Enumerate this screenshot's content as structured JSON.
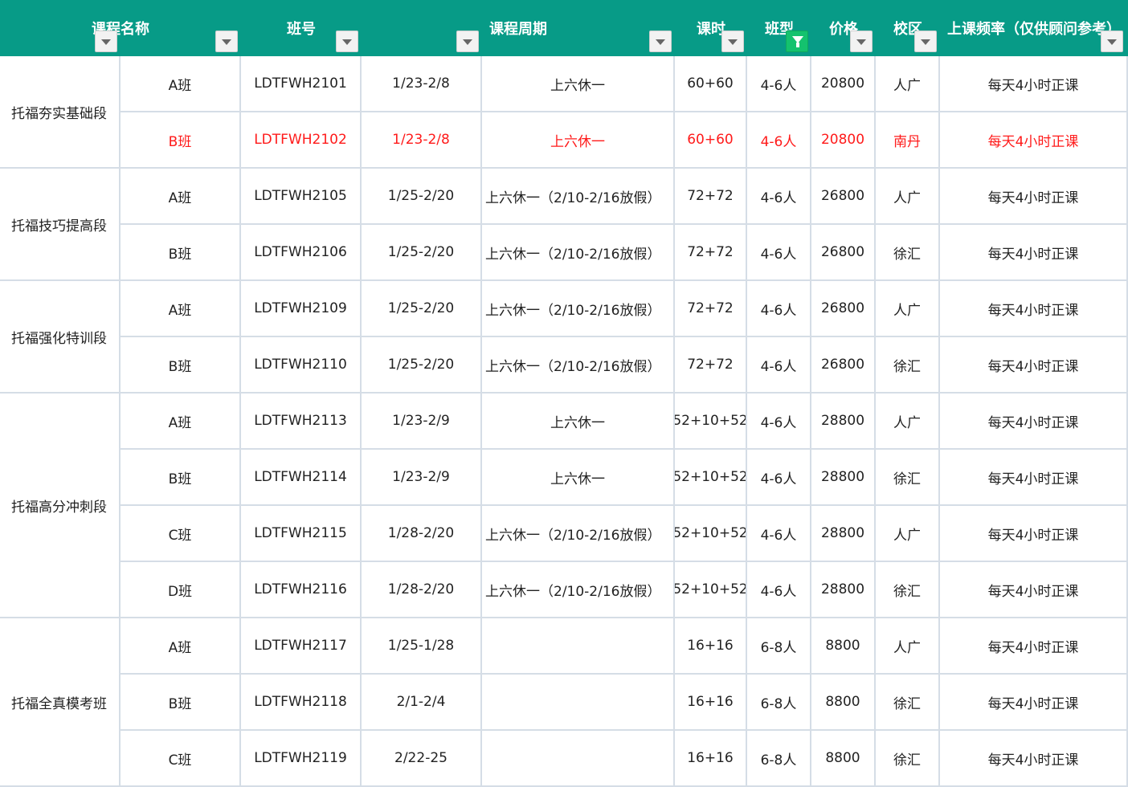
{
  "headers": [
    {
      "label": "课程名称",
      "filter_active": false
    },
    {
      "label": "班号",
      "filter_active": false
    },
    {
      "label": "课程周期",
      "filter_active": false
    },
    {
      "label": "课时",
      "filter_active": false
    },
    {
      "label": "班型",
      "filter_active": true
    },
    {
      "label": "价格",
      "filter_active": false
    },
    {
      "label": "校区",
      "filter_active": false
    },
    {
      "label": "上课频率（仅供顾问参考）",
      "filter_active": false
    }
  ],
  "groups": [
    {
      "name": "托福夯实基础段",
      "row_count": 2
    },
    {
      "name": "托福技巧提高段",
      "row_count": 2
    },
    {
      "name": "托福强化特训段",
      "row_count": 2
    },
    {
      "name": "托福高分冲刺段",
      "row_count": 4
    },
    {
      "name": "托福全真模考班",
      "row_count": 3
    }
  ],
  "rows": [
    {
      "class": "A班",
      "code": "LDTFWH2101",
      "dates": "1/23-2/8",
      "schedule": "上六休一",
      "hours": "60+60",
      "size": "4-6人",
      "price": "20800",
      "campus": "人广",
      "frequency": "每天4小时正课",
      "highlight": false
    },
    {
      "class": "B班",
      "code": "LDTFWH2102",
      "dates": "1/23-2/8",
      "schedule": "上六休一",
      "hours": "60+60",
      "size": "4-6人",
      "price": "20800",
      "campus": "南丹",
      "frequency": "每天4小时正课",
      "highlight": true
    },
    {
      "class": "A班",
      "code": "LDTFWH2105",
      "dates": "1/25-2/20",
      "schedule": "上六休一（2/10-2/16放假）",
      "hours": "72+72",
      "size": "4-6人",
      "price": "26800",
      "campus": "人广",
      "frequency": "每天4小时正课",
      "highlight": false
    },
    {
      "class": "B班",
      "code": "LDTFWH2106",
      "dates": "1/25-2/20",
      "schedule": "上六休一（2/10-2/16放假）",
      "hours": "72+72",
      "size": "4-6人",
      "price": "26800",
      "campus": "徐汇",
      "frequency": "每天4小时正课",
      "highlight": false
    },
    {
      "class": "A班",
      "code": "LDTFWH2109",
      "dates": "1/25-2/20",
      "schedule": "上六休一（2/10-2/16放假）",
      "hours": "72+72",
      "size": "4-6人",
      "price": "26800",
      "campus": "人广",
      "frequency": "每天4小时正课",
      "highlight": false
    },
    {
      "class": "B班",
      "code": "LDTFWH2110",
      "dates": "1/25-2/20",
      "schedule": "上六休一（2/10-2/16放假）",
      "hours": "72+72",
      "size": "4-6人",
      "price": "26800",
      "campus": "徐汇",
      "frequency": "每天4小时正课",
      "highlight": false
    },
    {
      "class": "A班",
      "code": "LDTFWH2113",
      "dates": "1/23-2/9",
      "schedule": "上六休一",
      "hours": "52+10+52",
      "size": "4-6人",
      "price": "28800",
      "campus": "人广",
      "frequency": "每天4小时正课",
      "highlight": false
    },
    {
      "class": "B班",
      "code": "LDTFWH2114",
      "dates": "1/23-2/9",
      "schedule": "上六休一",
      "hours": "52+10+52",
      "size": "4-6人",
      "price": "28800",
      "campus": "徐汇",
      "frequency": "每天4小时正课",
      "highlight": false
    },
    {
      "class": "C班",
      "code": "LDTFWH2115",
      "dates": "1/28-2/20",
      "schedule": "上六休一（2/10-2/16放假）",
      "hours": "52+10+52",
      "size": "4-6人",
      "price": "28800",
      "campus": "人广",
      "frequency": "每天4小时正课",
      "highlight": false
    },
    {
      "class": "D班",
      "code": "LDTFWH2116",
      "dates": "1/28-2/20",
      "schedule": "上六休一（2/10-2/16放假）",
      "hours": "52+10+52",
      "size": "4-6人",
      "price": "28800",
      "campus": "徐汇",
      "frequency": "每天4小时正课",
      "highlight": false
    },
    {
      "class": "A班",
      "code": "LDTFWH2117",
      "dates": "1/25-1/28",
      "schedule": "",
      "hours": "16+16",
      "size": "6-8人",
      "price": "8800",
      "campus": "人广",
      "frequency": "每天4小时正课",
      "highlight": false
    },
    {
      "class": "B班",
      "code": "LDTFWH2118",
      "dates": "2/1-2/4",
      "schedule": "",
      "hours": "16+16",
      "size": "6-8人",
      "price": "8800",
      "campus": "徐汇",
      "frequency": "每天4小时正课",
      "highlight": false
    },
    {
      "class": "C班",
      "code": "LDTFWH2119",
      "dates": "2/22-25",
      "schedule": "",
      "hours": "16+16",
      "size": "6-8人",
      "price": "8800",
      "campus": "徐汇",
      "frequency": "每天4小时正课",
      "highlight": false
    }
  ],
  "colors": {
    "header_bg": "#079b87",
    "highlight_text": "#ff1a1a",
    "grid_line": "#d5dde6",
    "active_filter": "#14c26e"
  }
}
